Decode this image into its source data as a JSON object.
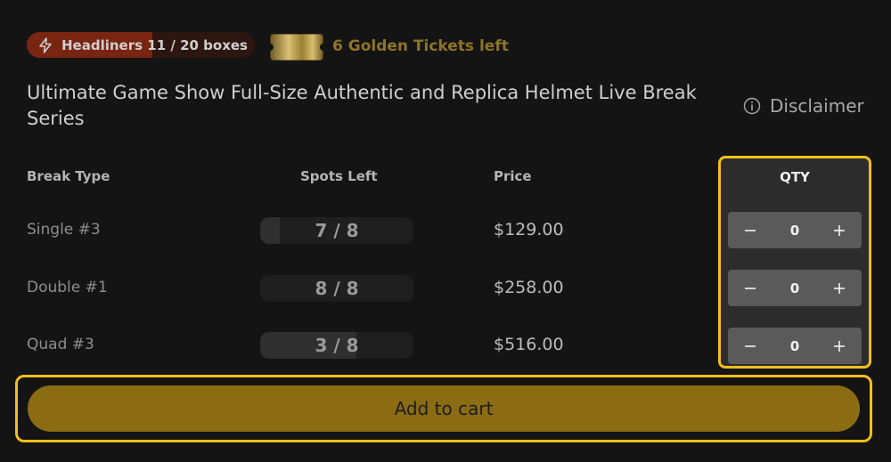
{
  "badges": {
    "headliners_label": "Headliners 11 / 20 boxes",
    "headliners_progress": 0.55,
    "headliners_color": "#7a2412",
    "golden_tickets": "6 Golden Tickets left",
    "golden_color": "#8d7427"
  },
  "product": {
    "title": "Ultimate Game Show Full-Size Authentic and Replica Helmet Live Break Series",
    "disclaimer": "Disclaimer"
  },
  "table": {
    "headers": {
      "break_type": "Break Type",
      "spots_left": "Spots Left",
      "price": "Price",
      "qty": "QTY"
    },
    "rows": [
      {
        "break_type": "Single #3",
        "spots": "7 / 8",
        "spots_remaining": 7,
        "spots_total": 8,
        "price": "$129.00",
        "qty": "0"
      },
      {
        "break_type": "Double #1",
        "spots": "8 / 8",
        "spots_remaining": 8,
        "spots_total": 8,
        "price": "$258.00",
        "qty": "0"
      },
      {
        "break_type": "Quad #3",
        "spots": "3 / 8",
        "spots_remaining": 3,
        "spots_total": 8,
        "price": "$516.00",
        "qty": "0"
      }
    ]
  },
  "cart": {
    "label": "Add to cart",
    "color": "#8b6c13"
  },
  "highlight_color": "#f2c01b",
  "icons": {
    "headliners": "lightning-bolt-icon",
    "golden": "golden-ticket-icon",
    "disclaimer": "info-circle-icon",
    "decrement": "minus-icon",
    "increment": "plus-icon"
  }
}
